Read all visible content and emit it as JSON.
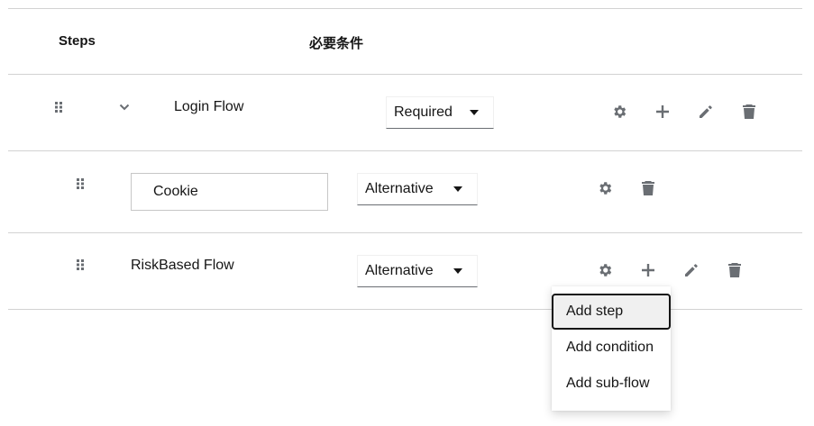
{
  "header": {
    "steps_label": "Steps",
    "requirement_label": "必要条件"
  },
  "rows": [
    {
      "name": "Login Flow",
      "requirement": "Required",
      "actions": [
        "gear-icon",
        "plus-icon",
        "pencil-icon",
        "trash-icon"
      ]
    },
    {
      "name": "Cookie",
      "requirement": "Alternative",
      "actions": [
        "gear-icon",
        "trash-icon"
      ]
    },
    {
      "name": "RiskBased Flow",
      "requirement": "Alternative",
      "actions": [
        "gear-icon",
        "plus-icon",
        "pencil-icon",
        "trash-icon"
      ]
    }
  ],
  "add_menu": {
    "items": [
      "Add step",
      "Add condition",
      "Add sub-flow"
    ],
    "focused_item": "Add step"
  },
  "colors": {
    "icon": "#6a6e73",
    "text": "#151515",
    "divider": "#d2d2d2",
    "focused_bg": "#f0f0f0"
  }
}
